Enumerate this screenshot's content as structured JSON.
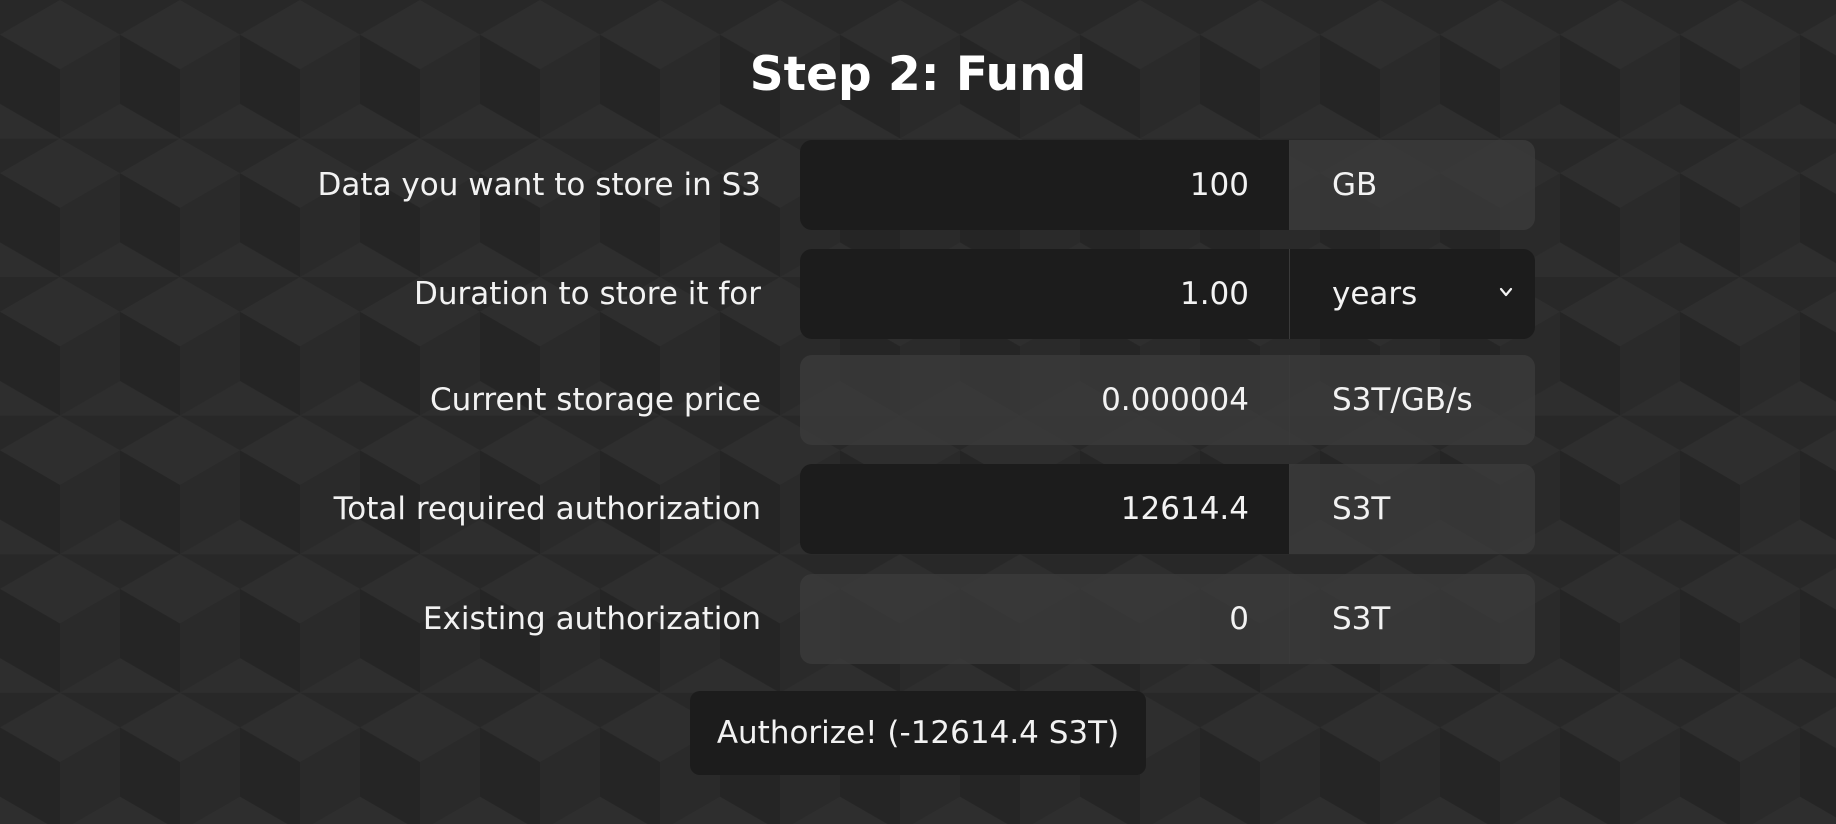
{
  "header": {
    "title": "Step 2: Fund"
  },
  "form": {
    "data_amount": {
      "label": "Data you want to store in S3",
      "value": "100",
      "unit": "GB"
    },
    "duration": {
      "label": "Duration to store it for",
      "value": "1.00",
      "unit": "years",
      "unit_icon": "chevron-down-icon"
    },
    "storage_price": {
      "label": "Current storage price",
      "value": "0.000004",
      "unit": "S3T/GB/s"
    },
    "total_authorization": {
      "label": "Total required authorization",
      "value": "12614.4",
      "unit": "S3T"
    },
    "existing_authorization": {
      "label": "Existing authorization",
      "value": "0",
      "unit": "S3T"
    }
  },
  "actions": {
    "authorize_label": "Authorize! (-12614.4 S3T)"
  },
  "colors": {
    "background": "#282828",
    "field_dark": "#1c1c1c",
    "field_light": "#3a3a3a",
    "text": "#f2f2f2"
  }
}
